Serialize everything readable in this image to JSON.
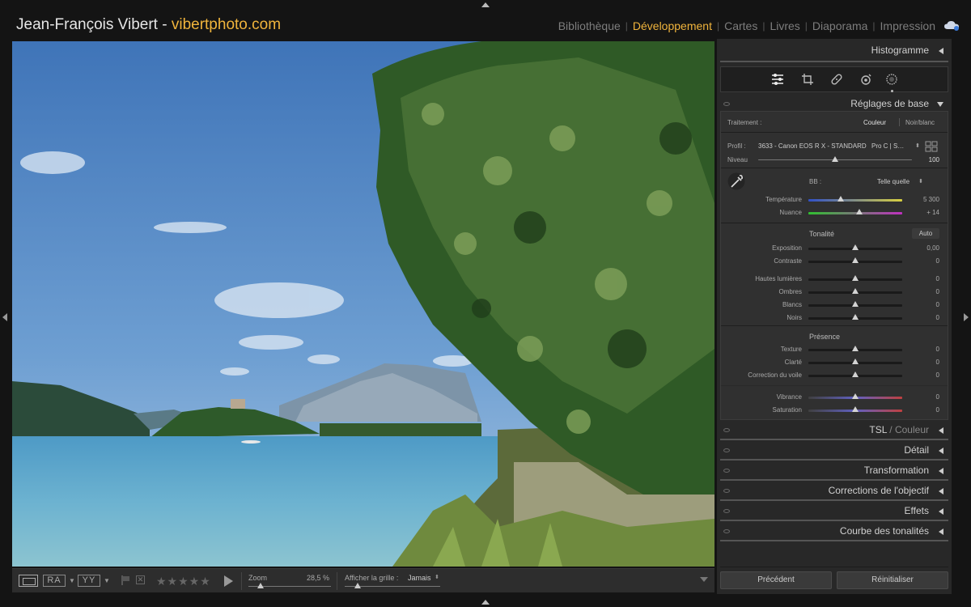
{
  "identity": {
    "name": "Jean-François Vibert - ",
    "site": "vibertphoto.com"
  },
  "modules": [
    "Bibliothèque",
    "Développement",
    "Cartes",
    "Livres",
    "Diaporama",
    "Impression"
  ],
  "active_module": "Développement",
  "toolbar": {
    "view_ra": "RA",
    "view_yy": "YY",
    "stars": "★★★★★",
    "zoom_label": "Zoom",
    "zoom_value": "28,5 %",
    "grid_label": "Afficher la grille :",
    "grid_value": "Jamais"
  },
  "panel": {
    "histogram": "Histogramme",
    "basic_title": "Réglages de base",
    "traitement_label": "Traitement :",
    "traitement_couleur": "Couleur",
    "traitement_nb": "Noir/blanc",
    "profil_label": "Profil :",
    "profil_value": "3633 - Canon EOS R X - STANDARD",
    "profil_extra": "Pro C | S…",
    "niveau_label": "Niveau",
    "niveau_value": "100",
    "bb_label": "BB :",
    "bb_value": "Telle quelle",
    "temperature_label": "Température",
    "temperature_value": "5 300",
    "nuance_label": "Nuance",
    "nuance_value": "+ 14",
    "tonalite": "Tonalité",
    "auto": "Auto",
    "exposition_label": "Exposition",
    "exposition_value": "0,00",
    "contraste_label": "Contraste",
    "contraste_value": "0",
    "hautes_label": "Hautes lumières",
    "hautes_value": "0",
    "ombres_label": "Ombres",
    "ombres_value": "0",
    "blancs_label": "Blancs",
    "blancs_value": "0",
    "noirs_label": "Noirs",
    "noirs_value": "0",
    "presence": "Présence",
    "texture_label": "Texture",
    "texture_value": "0",
    "clarte_label": "Clarté",
    "clarte_value": "0",
    "voile_label": "Correction du voile",
    "voile_value": "0",
    "vibrance_label": "Vibrance",
    "vibrance_value": "0",
    "saturation_label": "Saturation",
    "saturation_value": "0",
    "tsl": "TSL",
    "tsl_sep": " / ",
    "couleur": "Couleur",
    "detail": "Détail",
    "transformation": "Transformation",
    "objectif": "Corrections de l'objectif",
    "effets": "Effets",
    "courbe": "Courbe des tonalités",
    "precedent": "Précédent",
    "reinitialiser": "Réinitialiser"
  }
}
